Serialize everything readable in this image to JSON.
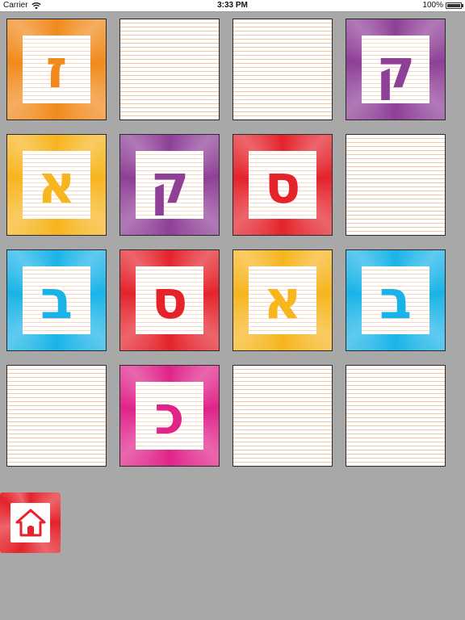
{
  "status_bar": {
    "carrier": "Carrier",
    "time": "3:33 PM",
    "battery": "100%",
    "battery_level": 1.0
  },
  "board": {
    "rows": 4,
    "cols": 4,
    "cards": [
      {
        "state": "face",
        "letter": "ז",
        "color": "#f08a1c"
      },
      {
        "state": "back"
      },
      {
        "state": "back"
      },
      {
        "state": "face",
        "letter": "ק",
        "color": "#8e3f96"
      },
      {
        "state": "face",
        "letter": "א",
        "color": "#f7b51e"
      },
      {
        "state": "face",
        "letter": "ק",
        "color": "#8e3f96"
      },
      {
        "state": "face",
        "letter": "ס",
        "color": "#e4232b"
      },
      {
        "state": "back"
      },
      {
        "state": "face",
        "letter": "ב",
        "color": "#1ab3e8"
      },
      {
        "state": "face",
        "letter": "ס",
        "color": "#e4232b"
      },
      {
        "state": "face",
        "letter": "א",
        "color": "#f7b51e"
      },
      {
        "state": "face",
        "letter": "ב",
        "color": "#1ab3e8"
      },
      {
        "state": "back"
      },
      {
        "state": "face",
        "letter": "כ",
        "color": "#e0248a"
      },
      {
        "state": "back"
      },
      {
        "state": "back"
      }
    ]
  },
  "home_button": {
    "icon": "home-icon",
    "color": "#e4232b"
  }
}
